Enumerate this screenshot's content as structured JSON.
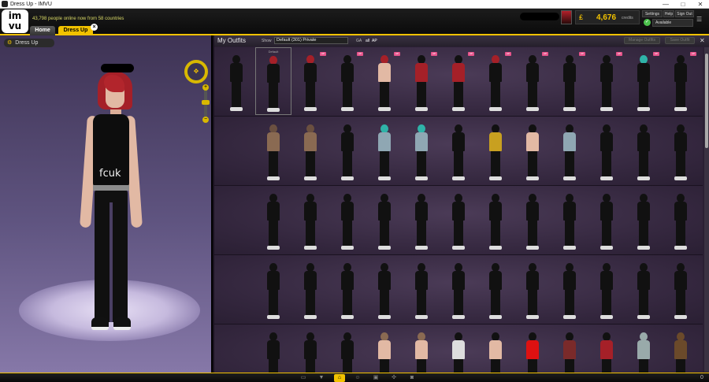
{
  "window": {
    "title": "Dress Up - IMVU",
    "buttons": [
      "—",
      "□",
      "✕"
    ]
  },
  "header": {
    "logo_line1": "im",
    "logo_line2": "vu",
    "online_text": "43,798 people online now from 58 countries",
    "tabs": [
      {
        "label": "Home"
      },
      {
        "label": "Dress Up"
      }
    ],
    "tab_close_glyph": "×",
    "credits": "4,676",
    "credits_label": "credits",
    "credit_icon": "₤",
    "buttons": {
      "settings": "Settings",
      "help": "Help",
      "signout": "Sign Out"
    },
    "status": "Available",
    "status_glyph": "✓",
    "menu_glyph": "☰"
  },
  "left": {
    "label": "Dress Up",
    "label_glyph": "⚙",
    "shirt_text": "fcuk",
    "camera_glyph": "✥",
    "zoom_plus": "+",
    "zoom_minus": "−"
  },
  "outfits": {
    "title": "My Outfits",
    "show_label": "Show",
    "filter_value": "Default (301) Private",
    "ga_label": "GA",
    "all_label": "all",
    "ap_label": "AP",
    "manage_label": "Manage Outfits",
    "save_label": "Save Outfit",
    "close_glyph": "✕",
    "default_label": "Default",
    "ap_badge": "AP",
    "rows": [
      [
        {
          "skin": "#111",
          "top": "#111",
          "hair": "#111",
          "sel": false,
          "label": ""
        },
        {
          "skin": "#e2b9a4",
          "top": "#111",
          "hair": "#a52028",
          "sel": true,
          "label": "Default"
        },
        {
          "skin": "#e2b9a4",
          "top": "#111",
          "hair": "#a52028",
          "sel": false,
          "label": "",
          "ap": true
        },
        {
          "skin": "#e2b9a4",
          "top": "#111",
          "hair": "#111",
          "sel": false,
          "label": "",
          "ap": true
        },
        {
          "skin": "#e2b9a4",
          "top": "#e2b9a4",
          "hair": "#a52028",
          "sel": false,
          "label": "",
          "ap": true
        },
        {
          "skin": "#e2b9a4",
          "top": "#a52028",
          "hair": "#111",
          "sel": false,
          "label": "",
          "ap": true
        },
        {
          "skin": "#e2b9a4",
          "top": "#a52028",
          "hair": "#111",
          "sel": false,
          "label": "",
          "ap": true
        },
        {
          "skin": "#e2b9a4",
          "top": "#111",
          "hair": "#a52028",
          "sel": false,
          "label": "",
          "ap": true
        },
        {
          "skin": "#e2b9a4",
          "top": "#111",
          "hair": "#111",
          "sel": false,
          "label": "",
          "ap": true
        },
        {
          "skin": "#e2b9a4",
          "top": "#111",
          "hair": "#111",
          "sel": false,
          "label": "",
          "ap": true
        },
        {
          "skin": "#e2b9a4",
          "top": "#111",
          "hair": "#111",
          "sel": false,
          "label": "",
          "ap": true
        },
        {
          "skin": "#e2b9a4",
          "top": "#111",
          "hair": "#2fb3a8",
          "sel": false,
          "label": "",
          "ap": true
        },
        {
          "skin": "#e2b9a4",
          "top": "#111",
          "hair": "#111",
          "sel": false,
          "label": "",
          "ap": true
        }
      ],
      [
        {
          "skin": "#e2b9a4",
          "top": "#111",
          "hair": "#111",
          "empty": true
        },
        {
          "skin": "#8a6a52",
          "top": "#8a6a52",
          "hair": "#6b5040"
        },
        {
          "skin": "#8a6a52",
          "top": "#8a6a52",
          "hair": "#6b5040"
        },
        {
          "skin": "#e2b9a4",
          "top": "#111",
          "hair": "#111"
        },
        {
          "skin": "#e2b9a4",
          "top": "#8fa7b3",
          "hair": "#2fb3a8"
        },
        {
          "skin": "#e2b9a4",
          "top": "#8fa7b3",
          "hair": "#2fb3a8"
        },
        {
          "skin": "#e2b9a4",
          "top": "#111",
          "hair": "#111"
        },
        {
          "skin": "#e2b9a4",
          "top": "#c8a020",
          "hair": "#111"
        },
        {
          "skin": "#e2b9a4",
          "top": "#e2b9a4",
          "hair": "#111"
        },
        {
          "skin": "#e2b9a4",
          "top": "#8fa7b3",
          "hair": "#111"
        },
        {
          "skin": "#e2b9a4",
          "top": "#111",
          "hair": "#111"
        },
        {
          "skin": "#e2b9a4",
          "top": "#111",
          "hair": "#111"
        },
        {
          "skin": "#e2b9a4",
          "top": "#111",
          "hair": "#111"
        }
      ],
      [
        {
          "skin": "#e2b9a4",
          "top": "#111",
          "hair": "#111",
          "empty": true
        },
        {
          "skin": "#e2b9a4",
          "top": "#111",
          "hair": "#111"
        },
        {
          "skin": "#e2b9a4",
          "top": "#111",
          "hair": "#111"
        },
        {
          "skin": "#e2b9a4",
          "top": "#111",
          "hair": "#111"
        },
        {
          "skin": "#e2b9a4",
          "top": "#111",
          "hair": "#111"
        },
        {
          "skin": "#e2b9a4",
          "top": "#111",
          "hair": "#111"
        },
        {
          "skin": "#e2b9a4",
          "top": "#111",
          "hair": "#111"
        },
        {
          "skin": "#e2b9a4",
          "top": "#111",
          "hair": "#111"
        },
        {
          "skin": "#e2b9a4",
          "top": "#111",
          "hair": "#111"
        },
        {
          "skin": "#e2b9a4",
          "top": "#111",
          "hair": "#111"
        },
        {
          "skin": "#e2b9a4",
          "top": "#111",
          "hair": "#111"
        },
        {
          "skin": "#e2b9a4",
          "top": "#111",
          "hair": "#111"
        },
        {
          "skin": "#e2b9a4",
          "top": "#111",
          "hair": "#111"
        }
      ],
      [
        {
          "skin": "#e2b9a4",
          "top": "#111",
          "hair": "#111",
          "empty": true
        },
        {
          "skin": "#e2b9a4",
          "top": "#111",
          "hair": "#111"
        },
        {
          "skin": "#e2b9a4",
          "top": "#111",
          "hair": "#111"
        },
        {
          "skin": "#e2b9a4",
          "top": "#111",
          "hair": "#111"
        },
        {
          "skin": "#e2b9a4",
          "top": "#111",
          "hair": "#111"
        },
        {
          "skin": "#e2b9a4",
          "top": "#111",
          "hair": "#111"
        },
        {
          "skin": "#e2b9a4",
          "top": "#111",
          "hair": "#111"
        },
        {
          "skin": "#e2b9a4",
          "top": "#111",
          "hair": "#111"
        },
        {
          "skin": "#e2b9a4",
          "top": "#111",
          "hair": "#111"
        },
        {
          "skin": "#e2b9a4",
          "top": "#111",
          "hair": "#111"
        },
        {
          "skin": "#e2b9a4",
          "top": "#111",
          "hair": "#111"
        },
        {
          "skin": "#e2b9a4",
          "top": "#111",
          "hair": "#111"
        },
        {
          "skin": "#e2b9a4",
          "top": "#111",
          "hair": "#111"
        }
      ],
      [
        {
          "skin": "#e2b9a4",
          "top": "#111",
          "hair": "#111",
          "empty": true
        },
        {
          "skin": "#e2b9a4",
          "top": "#111",
          "hair": "#111"
        },
        {
          "skin": "#e2b9a4",
          "top": "#111",
          "hair": "#111"
        },
        {
          "skin": "#e2b9a4",
          "top": "#111",
          "hair": "#111"
        },
        {
          "skin": "#e2b9a4",
          "top": "#e2b9a4",
          "hair": "#8a6a52"
        },
        {
          "skin": "#e2b9a4",
          "top": "#e2b9a4",
          "hair": "#8a6a52"
        },
        {
          "skin": "#e2b9a4",
          "top": "#ddd",
          "hair": "#111"
        },
        {
          "skin": "#e2b9a4",
          "top": "#e2b9a4",
          "hair": "#111"
        },
        {
          "skin": "#e2b9a4",
          "top": "#d11",
          "hair": "#111"
        },
        {
          "skin": "#e2b9a4",
          "top": "#7a2a2a",
          "hair": "#111"
        },
        {
          "skin": "#e2b9a4",
          "top": "#a52028",
          "hair": "#111"
        },
        {
          "skin": "#9aa",
          "top": "#9aa",
          "hair": "#9aa"
        },
        {
          "skin": "#6b4a2a",
          "top": "#6b4a2a",
          "hair": "#6b4a2a"
        }
      ]
    ]
  },
  "bottombar": {
    "icons": [
      {
        "name": "chat-icon",
        "glyph": "▭"
      },
      {
        "name": "shirt-icon",
        "glyph": "▼"
      },
      {
        "name": "hanger-icon",
        "glyph": "⌂",
        "active": true
      },
      {
        "name": "people-icon",
        "glyph": "☺"
      },
      {
        "name": "shop-icon",
        "glyph": "▣"
      },
      {
        "name": "puzzle-icon",
        "glyph": "✣"
      },
      {
        "name": "camera-icon",
        "glyph": "◙"
      }
    ],
    "right_label": "0"
  },
  "colors": {
    "accent": "#f2c200",
    "pane_bg": "#2a1f33"
  }
}
